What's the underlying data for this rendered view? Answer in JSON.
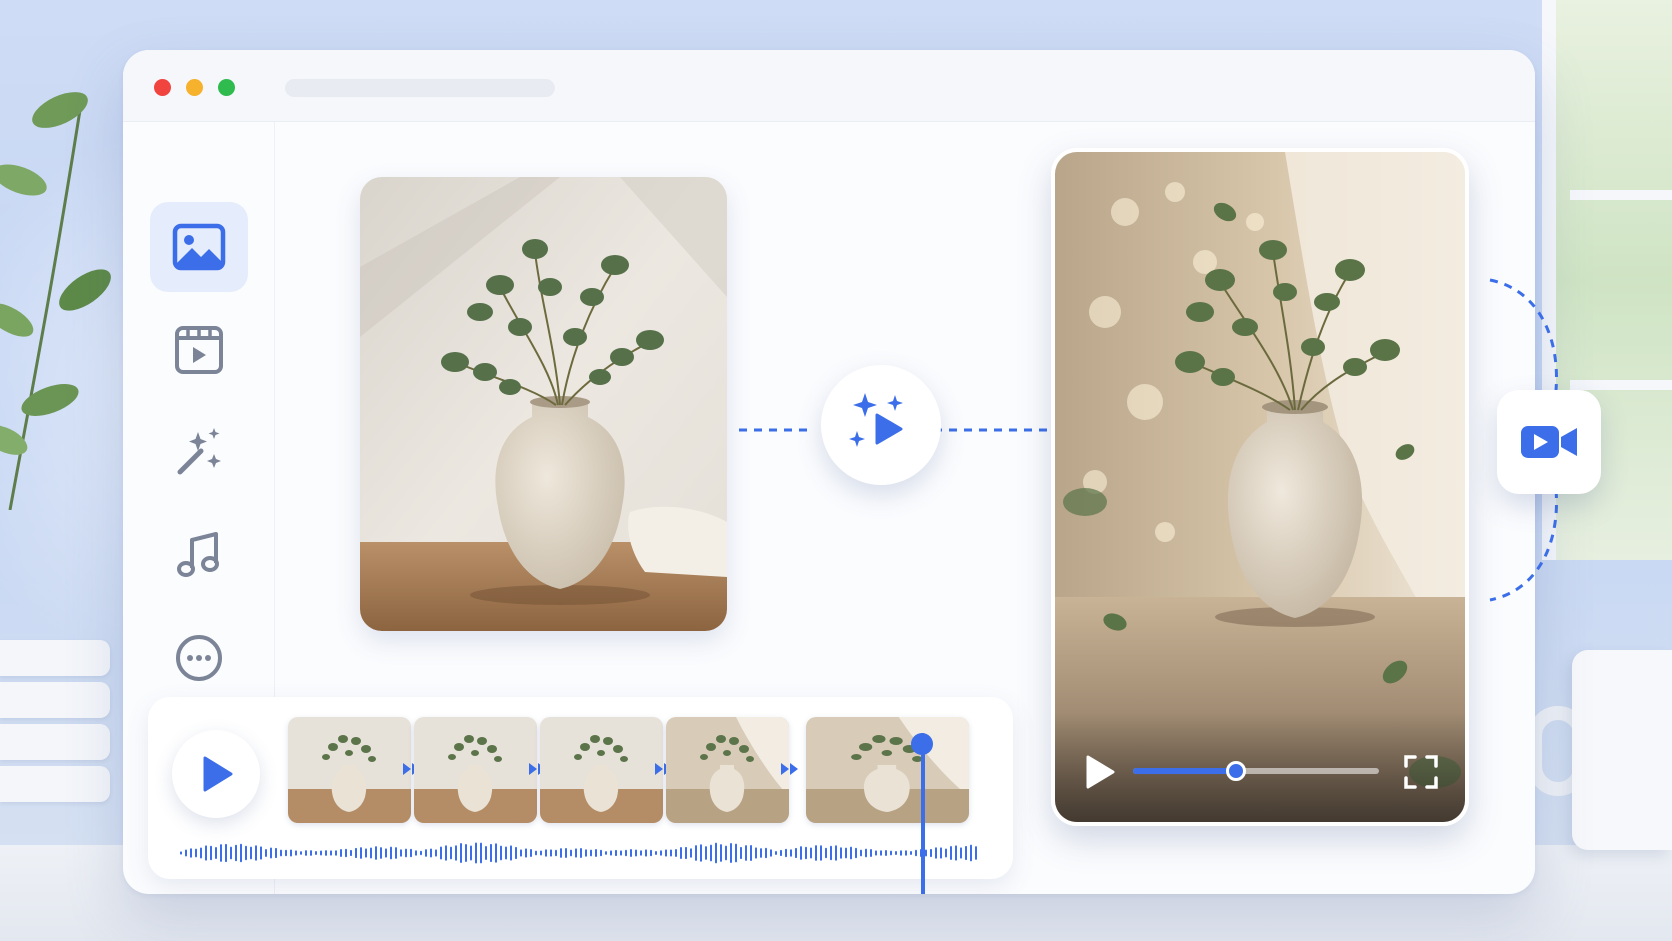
{
  "window": {
    "traffic_lights": [
      "close",
      "minimize",
      "zoom"
    ],
    "address_bar_text": ""
  },
  "sidebar": {
    "items": [
      {
        "name": "image",
        "icon": "image-icon",
        "active": true
      },
      {
        "name": "video",
        "icon": "video-frame-icon",
        "active": false
      },
      {
        "name": "ai-effects",
        "icon": "magic-wand-icon",
        "active": false
      },
      {
        "name": "music",
        "icon": "music-note-icon",
        "active": false
      },
      {
        "name": "more",
        "icon": "more-icon",
        "active": false
      }
    ]
  },
  "canvas": {
    "source_image": "vase-photo",
    "generate_icon": "sparkle-play-icon",
    "result_video": "vase-video",
    "export_icon": "video-camera-icon"
  },
  "video_player": {
    "progress": 0.42,
    "play_icon": "play-icon",
    "fullscreen_icon": "fullscreen-icon"
  },
  "timeline": {
    "frame_count": 5,
    "playhead_position": 0.76,
    "play_icon": "play-icon",
    "waveform": "audio-waveform"
  },
  "colors": {
    "accent": "#3b6ee8",
    "close": "#f1443f",
    "minimize": "#f6b12d",
    "zoom": "#2fbb4e",
    "sidebar_icon": "#7c8598",
    "active_bg": "#e5ecfb"
  }
}
